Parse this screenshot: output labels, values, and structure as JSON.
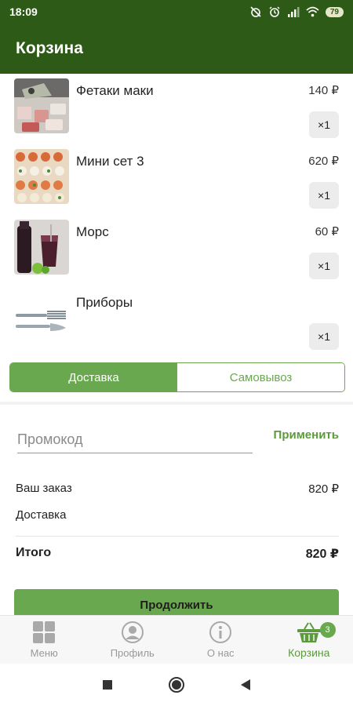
{
  "status_bar": {
    "time": "18:09",
    "battery": "79"
  },
  "app_bar": {
    "title": "Корзина"
  },
  "cart": {
    "items": [
      {
        "name": "Фетаки маки",
        "price": "140 ₽",
        "quantity": "×1",
        "image": "sushi-roll-photo"
      },
      {
        "name": "Мини сет 3",
        "price": "620 ₽",
        "quantity": "×1",
        "image": "sushi-set-photo"
      },
      {
        "name": "Морс",
        "price": "60 ₽",
        "quantity": "×1",
        "image": "drink-photo"
      },
      {
        "name": "Приборы",
        "price": "",
        "quantity": "×1",
        "image": "cutlery-photo"
      }
    ]
  },
  "delivery_toggle": {
    "delivery": "Доставка",
    "pickup": "Самовывоз",
    "selected": "delivery"
  },
  "promo": {
    "placeholder": "Промокод",
    "value": "",
    "apply": "Применить"
  },
  "summary": {
    "order_label": "Ваш заказ",
    "order_value": "820 ₽",
    "delivery_label": "Доставка",
    "delivery_value": "",
    "total_label": "Итого",
    "total_value": "820 ₽"
  },
  "continue_button": "Продолжить",
  "bottom_nav": {
    "items": [
      {
        "label": "Меню",
        "icon": "grid-icon"
      },
      {
        "label": "Профиль",
        "icon": "profile-icon"
      },
      {
        "label": "О нас",
        "icon": "info-icon"
      },
      {
        "label": "Корзина",
        "icon": "basket-icon",
        "badge": "3",
        "active": true
      }
    ]
  },
  "colors": {
    "header": "#2d5a17",
    "accent": "#6aa84f",
    "accent_text": "#5b9b3c"
  }
}
